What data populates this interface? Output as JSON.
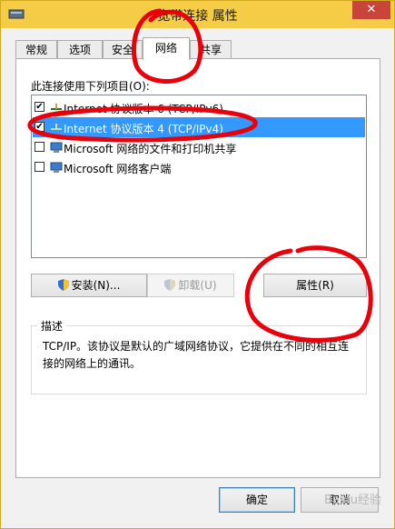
{
  "window": {
    "title": "宽带连接 属性",
    "close_glyph": "✕"
  },
  "tabs": [
    {
      "label": "常规"
    },
    {
      "label": "选项"
    },
    {
      "label": "安全"
    },
    {
      "label": "网络",
      "active": true
    },
    {
      "label": "共享"
    }
  ],
  "main": {
    "list_label": "此连接使用下列项目(O):",
    "items": [
      {
        "label": "Internet 协议版本 6 (TCP/IPv6)",
        "checked": true,
        "selected": false,
        "icon": "network-protocol-icon"
      },
      {
        "label": "Internet 协议版本 4 (TCP/IPv4)",
        "checked": true,
        "selected": true,
        "icon": "network-protocol-icon"
      },
      {
        "label": "Microsoft 网络的文件和打印机共享",
        "checked": false,
        "selected": false,
        "icon": "network-service-icon"
      },
      {
        "label": "Microsoft 网络客户端",
        "checked": false,
        "selected": false,
        "icon": "network-client-icon"
      }
    ],
    "buttons": {
      "install": "安装(N)...",
      "uninstall": "卸载(U)",
      "properties": "属性(R)"
    },
    "description": {
      "label": "描述",
      "text": "TCP/IP。该协议是默认的广域网络协议，它提供在不同的相互连接的网络上的通讯。"
    }
  },
  "footer": {
    "ok": "确定",
    "cancel": "取消"
  },
  "watermark": "Baidu经验",
  "colors": {
    "titlebar": "#f5cc45",
    "selection": "#3399ff",
    "annotation_red": "#e8000b"
  }
}
